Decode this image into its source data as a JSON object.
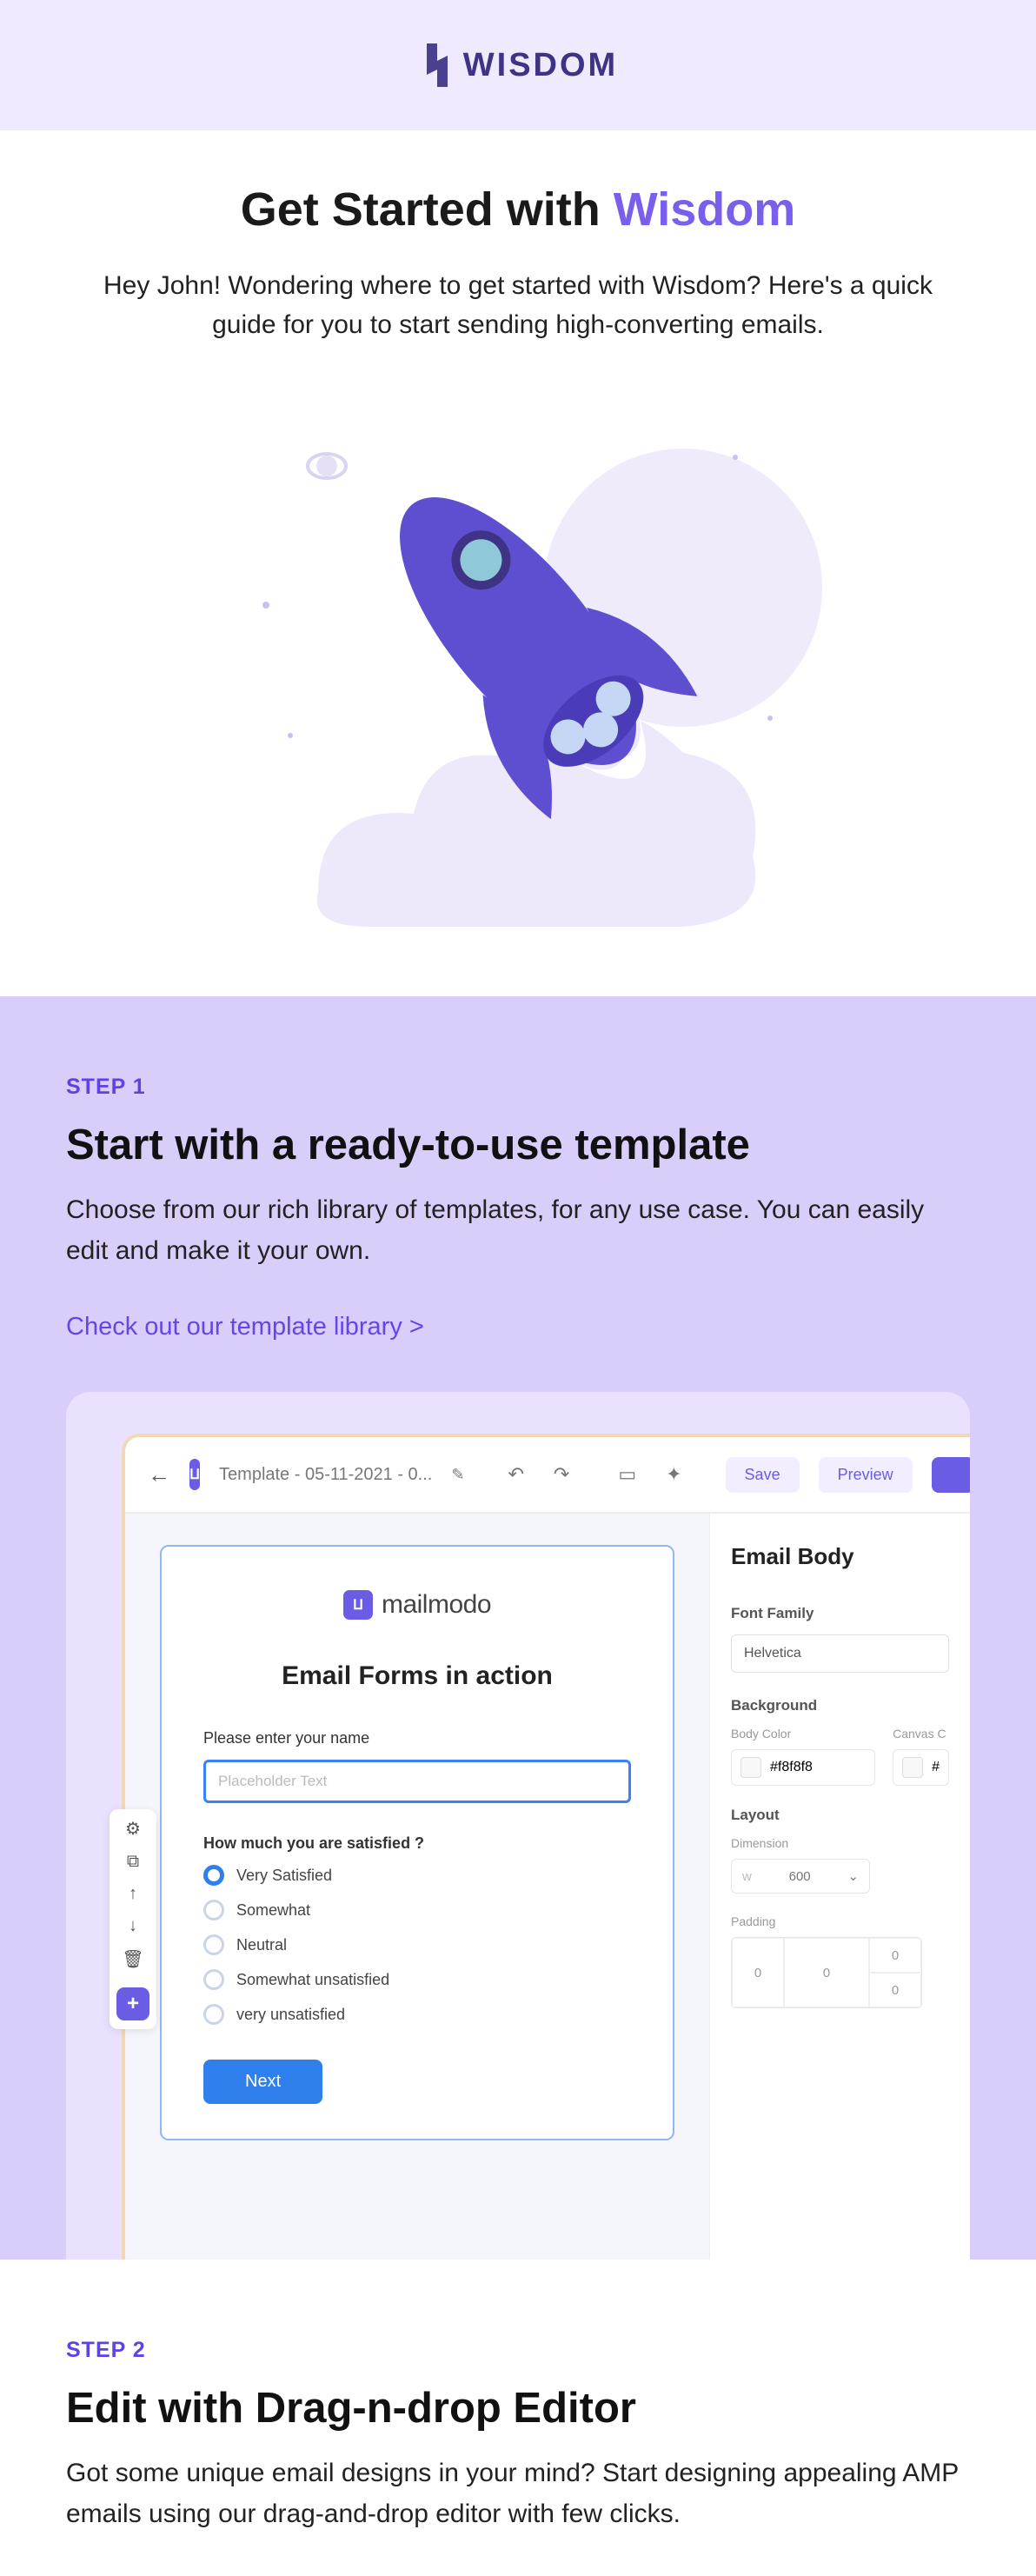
{
  "brand": {
    "name": "WISDOM"
  },
  "hero": {
    "title_prefix": "Get Started with ",
    "title_accent": "Wisdom",
    "body": "Hey John! Wondering where to get started with Wisdom? Here's a quick guide for you to start sending high-converting emails."
  },
  "step1": {
    "label": "STEP 1",
    "title": "Start with a ready-to-use template",
    "body": "Choose from our rich library of templates, for any use case. You can easily edit and make it your own.",
    "link": "Check out our template library >"
  },
  "step2": {
    "label": "STEP 2",
    "title": "Edit with Drag-n-drop Editor",
    "body": "Got some unique email designs in your mind? Start designing appealing AMP emails using our drag-and-drop editor with few clicks."
  },
  "editor": {
    "doc_title": "Template - 05-11-2021 - 0...",
    "save": "Save",
    "preview": "Preview",
    "brand": "mailmodo",
    "form_heading": "Email Forms in action",
    "name_label": "Please enter your name",
    "name_placeholder": "Placeholder Text",
    "question": "How much you are satisfied ?",
    "options": [
      "Very Satisfied",
      "Somewhat",
      "Neutral",
      "Somewhat unsatisfied",
      "very unsatisfied"
    ],
    "next": "Next",
    "panel": {
      "heading": "Email Body",
      "font_label": "Font Family",
      "font_value": "Helvetica",
      "bg_label": "Background",
      "body_color_label": "Body Color",
      "canvas_color_label": "Canvas C",
      "body_color_value": "#f8f8f8",
      "canvas_color_value": "#",
      "layout_label": "Layout",
      "dimension_label": "Dimension",
      "dimension_w": "w",
      "dimension_value": "600",
      "padding_label": "Padding",
      "pad_top": "0",
      "pad_left": "0",
      "pad_right": "0",
      "pad_bottom": "0"
    }
  }
}
